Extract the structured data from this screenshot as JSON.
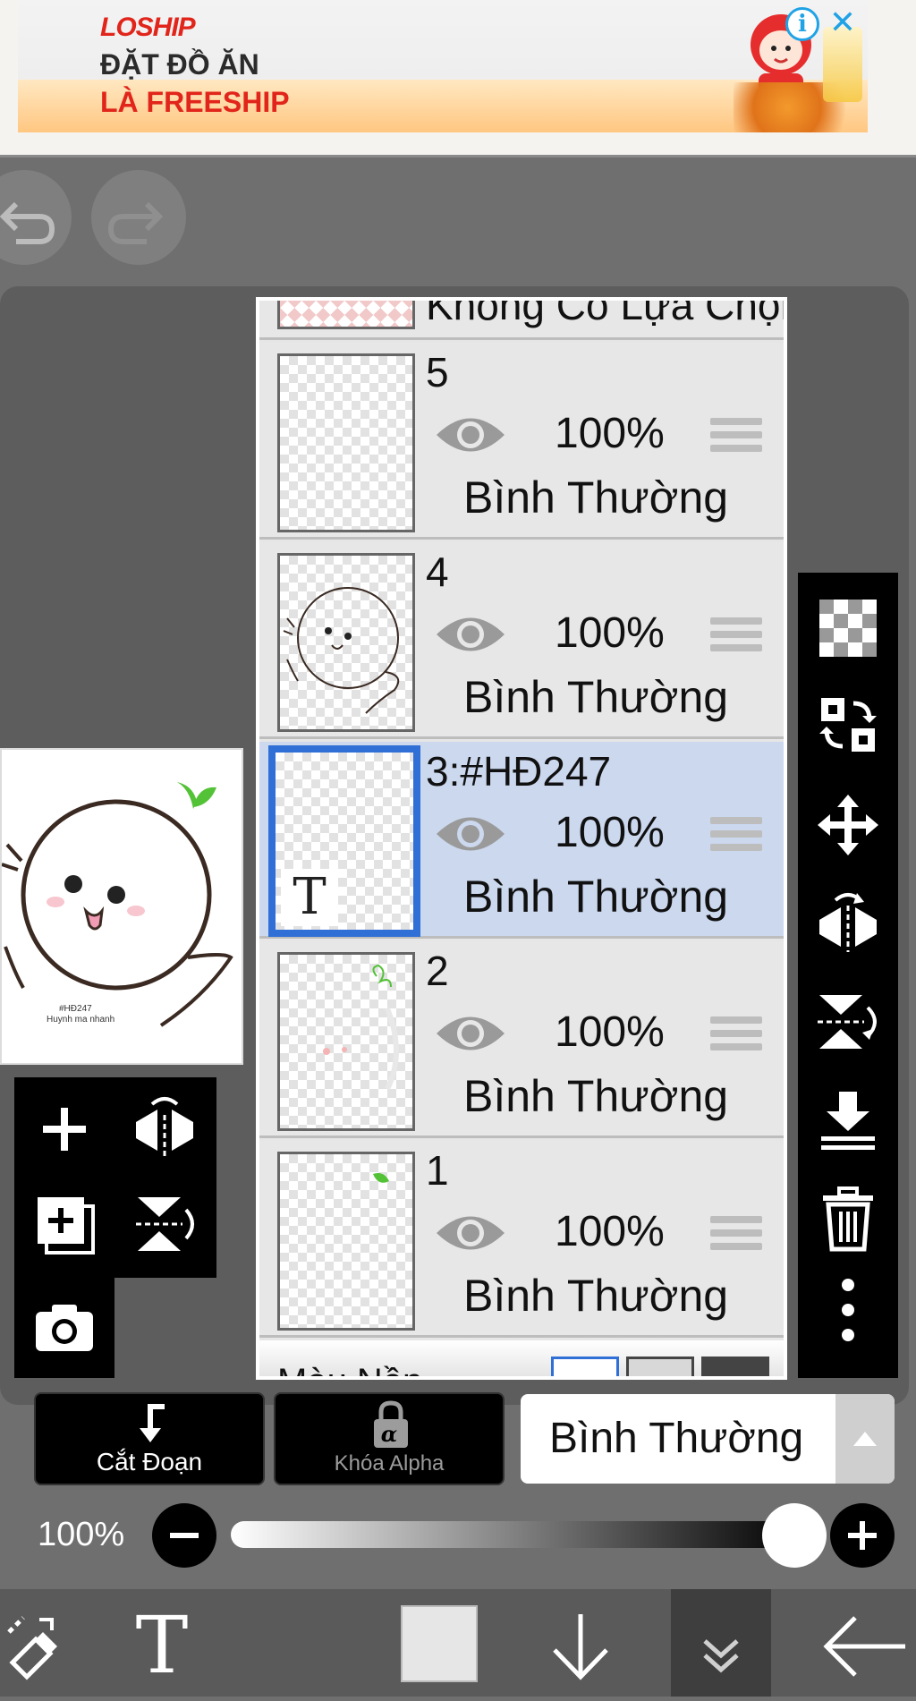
{
  "ad": {
    "brand": "LOSHIP",
    "line1": "ĐẶT ĐỒ ĂN",
    "line2": "LÀ FREESHIP",
    "info_icon": "i",
    "close_icon": "✕"
  },
  "layers_panel": {
    "top_partial_label": "Không Có Lựa Chọn",
    "layers": [
      {
        "name": "5",
        "opacity": "100%",
        "blend": "Bình Thường",
        "selected": false
      },
      {
        "name": "4",
        "opacity": "100%",
        "blend": "Bình Thường",
        "selected": false
      },
      {
        "name": "3:#HĐ247",
        "opacity": "100%",
        "blend": "Bình Thường",
        "selected": true,
        "text_layer_badge": "T"
      },
      {
        "name": "2",
        "opacity": "100%",
        "blend": "Bình Thường",
        "selected": false
      },
      {
        "name": "1",
        "opacity": "100%",
        "blend": "Bình Thường",
        "selected": false
      }
    ],
    "bottom_partial_label": "Màu Nền"
  },
  "preview": {
    "caption_line1": "#HĐ247",
    "caption_line2": "Huynh ma nhanh"
  },
  "controls": {
    "clip_label": "Cắt Đoạn",
    "alpha_lock_label": "Khóa Alpha",
    "alpha_symbol": "α",
    "blend_mode": "Bình Thường",
    "opacity_label": "100%",
    "opacity_value": 100
  },
  "bottom_bar": {
    "text_tool": "T"
  },
  "icons": {
    "right_toolbar": [
      "transparency-icon",
      "swap-layer-icon",
      "move-icon",
      "flip-horizontal-icon",
      "flip-vertical-icon",
      "merge-down-icon",
      "trash-icon",
      "more-icon"
    ],
    "left_tools": [
      "add-layer-icon",
      "flip-h-icon",
      "add-copy-icon",
      "flip-v-icon",
      "camera-icon"
    ]
  },
  "colors": {
    "selected_layer_bg": "#cbd8ee",
    "selected_border": "#2f6fd6",
    "ad_red": "#e1251b",
    "info_blue": "#20a3e6"
  }
}
